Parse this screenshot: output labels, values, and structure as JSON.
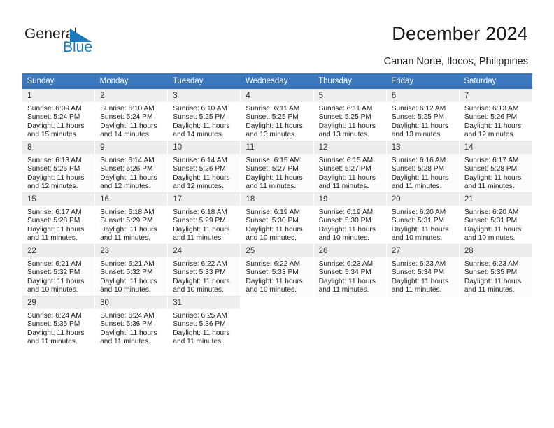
{
  "brand": {
    "name_top": "General",
    "name_bottom": "Blue",
    "triangle_icon": "triangle-icon",
    "color_dark": "#231f20",
    "color_blue": "#1a7bc0"
  },
  "header": {
    "title": "December 2024",
    "subtitle": "Canan Norte, Ilocos, Philippines"
  },
  "theme": {
    "header_blue": "#3b77bd",
    "daynum_gray": "#efefef",
    "text": "#222222"
  },
  "weekdays": [
    "Sunday",
    "Monday",
    "Tuesday",
    "Wednesday",
    "Thursday",
    "Friday",
    "Saturday"
  ],
  "weeks": [
    [
      {
        "day": "1",
        "sunrise": "Sunrise: 6:09 AM",
        "sunset": "Sunset: 5:24 PM",
        "daylight1": "Daylight: 11 hours",
        "daylight2": "and 15 minutes."
      },
      {
        "day": "2",
        "sunrise": "Sunrise: 6:10 AM",
        "sunset": "Sunset: 5:24 PM",
        "daylight1": "Daylight: 11 hours",
        "daylight2": "and 14 minutes."
      },
      {
        "day": "3",
        "sunrise": "Sunrise: 6:10 AM",
        "sunset": "Sunset: 5:25 PM",
        "daylight1": "Daylight: 11 hours",
        "daylight2": "and 14 minutes."
      },
      {
        "day": "4",
        "sunrise": "Sunrise: 6:11 AM",
        "sunset": "Sunset: 5:25 PM",
        "daylight1": "Daylight: 11 hours",
        "daylight2": "and 13 minutes."
      },
      {
        "day": "5",
        "sunrise": "Sunrise: 6:11 AM",
        "sunset": "Sunset: 5:25 PM",
        "daylight1": "Daylight: 11 hours",
        "daylight2": "and 13 minutes."
      },
      {
        "day": "6",
        "sunrise": "Sunrise: 6:12 AM",
        "sunset": "Sunset: 5:25 PM",
        "daylight1": "Daylight: 11 hours",
        "daylight2": "and 13 minutes."
      },
      {
        "day": "7",
        "sunrise": "Sunrise: 6:13 AM",
        "sunset": "Sunset: 5:26 PM",
        "daylight1": "Daylight: 11 hours",
        "daylight2": "and 12 minutes."
      }
    ],
    [
      {
        "day": "8",
        "sunrise": "Sunrise: 6:13 AM",
        "sunset": "Sunset: 5:26 PM",
        "daylight1": "Daylight: 11 hours",
        "daylight2": "and 12 minutes."
      },
      {
        "day": "9",
        "sunrise": "Sunrise: 6:14 AM",
        "sunset": "Sunset: 5:26 PM",
        "daylight1": "Daylight: 11 hours",
        "daylight2": "and 12 minutes."
      },
      {
        "day": "10",
        "sunrise": "Sunrise: 6:14 AM",
        "sunset": "Sunset: 5:26 PM",
        "daylight1": "Daylight: 11 hours",
        "daylight2": "and 12 minutes."
      },
      {
        "day": "11",
        "sunrise": "Sunrise: 6:15 AM",
        "sunset": "Sunset: 5:27 PM",
        "daylight1": "Daylight: 11 hours",
        "daylight2": "and 11 minutes."
      },
      {
        "day": "12",
        "sunrise": "Sunrise: 6:15 AM",
        "sunset": "Sunset: 5:27 PM",
        "daylight1": "Daylight: 11 hours",
        "daylight2": "and 11 minutes."
      },
      {
        "day": "13",
        "sunrise": "Sunrise: 6:16 AM",
        "sunset": "Sunset: 5:28 PM",
        "daylight1": "Daylight: 11 hours",
        "daylight2": "and 11 minutes."
      },
      {
        "day": "14",
        "sunrise": "Sunrise: 6:17 AM",
        "sunset": "Sunset: 5:28 PM",
        "daylight1": "Daylight: 11 hours",
        "daylight2": "and 11 minutes."
      }
    ],
    [
      {
        "day": "15",
        "sunrise": "Sunrise: 6:17 AM",
        "sunset": "Sunset: 5:28 PM",
        "daylight1": "Daylight: 11 hours",
        "daylight2": "and 11 minutes."
      },
      {
        "day": "16",
        "sunrise": "Sunrise: 6:18 AM",
        "sunset": "Sunset: 5:29 PM",
        "daylight1": "Daylight: 11 hours",
        "daylight2": "and 11 minutes."
      },
      {
        "day": "17",
        "sunrise": "Sunrise: 6:18 AM",
        "sunset": "Sunset: 5:29 PM",
        "daylight1": "Daylight: 11 hours",
        "daylight2": "and 11 minutes."
      },
      {
        "day": "18",
        "sunrise": "Sunrise: 6:19 AM",
        "sunset": "Sunset: 5:30 PM",
        "daylight1": "Daylight: 11 hours",
        "daylight2": "and 10 minutes."
      },
      {
        "day": "19",
        "sunrise": "Sunrise: 6:19 AM",
        "sunset": "Sunset: 5:30 PM",
        "daylight1": "Daylight: 11 hours",
        "daylight2": "and 10 minutes."
      },
      {
        "day": "20",
        "sunrise": "Sunrise: 6:20 AM",
        "sunset": "Sunset: 5:31 PM",
        "daylight1": "Daylight: 11 hours",
        "daylight2": "and 10 minutes."
      },
      {
        "day": "21",
        "sunrise": "Sunrise: 6:20 AM",
        "sunset": "Sunset: 5:31 PM",
        "daylight1": "Daylight: 11 hours",
        "daylight2": "and 10 minutes."
      }
    ],
    [
      {
        "day": "22",
        "sunrise": "Sunrise: 6:21 AM",
        "sunset": "Sunset: 5:32 PM",
        "daylight1": "Daylight: 11 hours",
        "daylight2": "and 10 minutes."
      },
      {
        "day": "23",
        "sunrise": "Sunrise: 6:21 AM",
        "sunset": "Sunset: 5:32 PM",
        "daylight1": "Daylight: 11 hours",
        "daylight2": "and 10 minutes."
      },
      {
        "day": "24",
        "sunrise": "Sunrise: 6:22 AM",
        "sunset": "Sunset: 5:33 PM",
        "daylight1": "Daylight: 11 hours",
        "daylight2": "and 10 minutes."
      },
      {
        "day": "25",
        "sunrise": "Sunrise: 6:22 AM",
        "sunset": "Sunset: 5:33 PM",
        "daylight1": "Daylight: 11 hours",
        "daylight2": "and 10 minutes."
      },
      {
        "day": "26",
        "sunrise": "Sunrise: 6:23 AM",
        "sunset": "Sunset: 5:34 PM",
        "daylight1": "Daylight: 11 hours",
        "daylight2": "and 11 minutes."
      },
      {
        "day": "27",
        "sunrise": "Sunrise: 6:23 AM",
        "sunset": "Sunset: 5:34 PM",
        "daylight1": "Daylight: 11 hours",
        "daylight2": "and 11 minutes."
      },
      {
        "day": "28",
        "sunrise": "Sunrise: 6:23 AM",
        "sunset": "Sunset: 5:35 PM",
        "daylight1": "Daylight: 11 hours",
        "daylight2": "and 11 minutes."
      }
    ],
    [
      {
        "day": "29",
        "sunrise": "Sunrise: 6:24 AM",
        "sunset": "Sunset: 5:35 PM",
        "daylight1": "Daylight: 11 hours",
        "daylight2": "and 11 minutes."
      },
      {
        "day": "30",
        "sunrise": "Sunrise: 6:24 AM",
        "sunset": "Sunset: 5:36 PM",
        "daylight1": "Daylight: 11 hours",
        "daylight2": "and 11 minutes."
      },
      {
        "day": "31",
        "sunrise": "Sunrise: 6:25 AM",
        "sunset": "Sunset: 5:36 PM",
        "daylight1": "Daylight: 11 hours",
        "daylight2": "and 11 minutes."
      },
      null,
      null,
      null,
      null
    ]
  ]
}
